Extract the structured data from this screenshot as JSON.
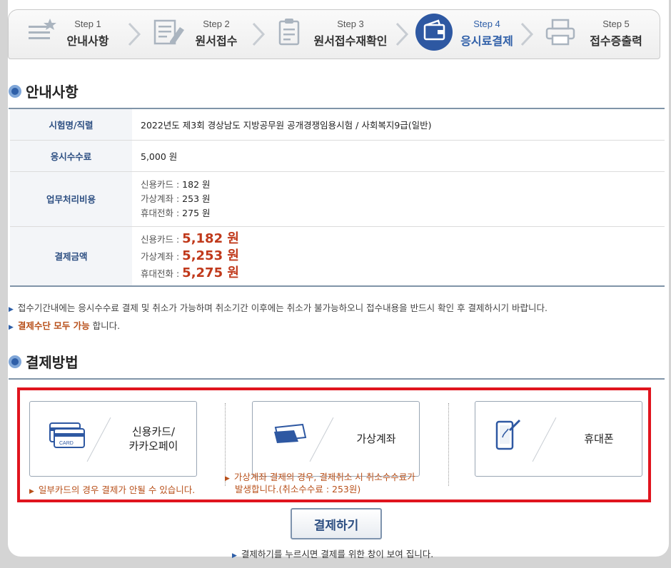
{
  "steps": [
    {
      "label": "Step 1",
      "title": "안내사항",
      "icon": "list-star-icon"
    },
    {
      "label": "Step 2",
      "title": "원서접수",
      "icon": "form-edit-icon"
    },
    {
      "label": "Step 3",
      "title": "원서접수재확인",
      "icon": "clipboard-icon"
    },
    {
      "label": "Step 4",
      "title": "응시료결제",
      "icon": "wallet-icon",
      "active": true
    },
    {
      "label": "Step 5",
      "title": "접수증출력",
      "icon": "printer-icon"
    }
  ],
  "notice_section": {
    "title": "안내사항"
  },
  "info": {
    "exam_label": "시험명/직렬",
    "exam_value": "2022년도 제3회 경상남도 지방공무원 공개경쟁임용시험 / 사회복지9급(일반)",
    "fee_label": "응시수수료",
    "fee_value": "5,000 원",
    "proc_label": "업무처리비용",
    "proc": [
      {
        "method": "신용카드 : ",
        "amount": "182 원"
      },
      {
        "method": "가상계좌 : ",
        "amount": "253 원"
      },
      {
        "method": "휴대전화 : ",
        "amount": "275 원"
      }
    ],
    "total_label": "결제금액",
    "total": [
      {
        "method": "신용카드 : ",
        "amount": "5,182 원"
      },
      {
        "method": "가상계좌 : ",
        "amount": "5,253 원"
      },
      {
        "method": "휴대전화 : ",
        "amount": "5,275 원"
      }
    ]
  },
  "notes": {
    "line1": "접수기간내에는 응시수수료 결제 및 취소가 가능하며 취소기간 이후에는 취소가 불가능하오니 접수내용을 반드시 확인 후 결제하시기 바랍니다.",
    "line2_highlight": "결제수단 모두 가능",
    "line2_rest": " 합니다."
  },
  "payment_section": {
    "title": "결제방법"
  },
  "payment": {
    "card_label_1": "신용카드/",
    "card_label_2": "카카오페이",
    "card_icon_text": "CARD",
    "vbank_label": "가상계좌",
    "phone_label": "휴대폰",
    "card_note": "일부카드의 경우 결제가 안될 수 있습니다.",
    "vbank_note_1": "가상계좌 결제의 경우, 결제취소 시 취소수수료가",
    "vbank_note_2": "발생합니다.(취소수수료 : 253원)"
  },
  "pay_button": "결제하기",
  "footer_note": "결제하기를 누르시면 결제를 위한 창이 보여 집니다.",
  "colors": {
    "accent": "#2e58a2",
    "highlight": "#c0391b",
    "selection_border": "#e0141e"
  }
}
